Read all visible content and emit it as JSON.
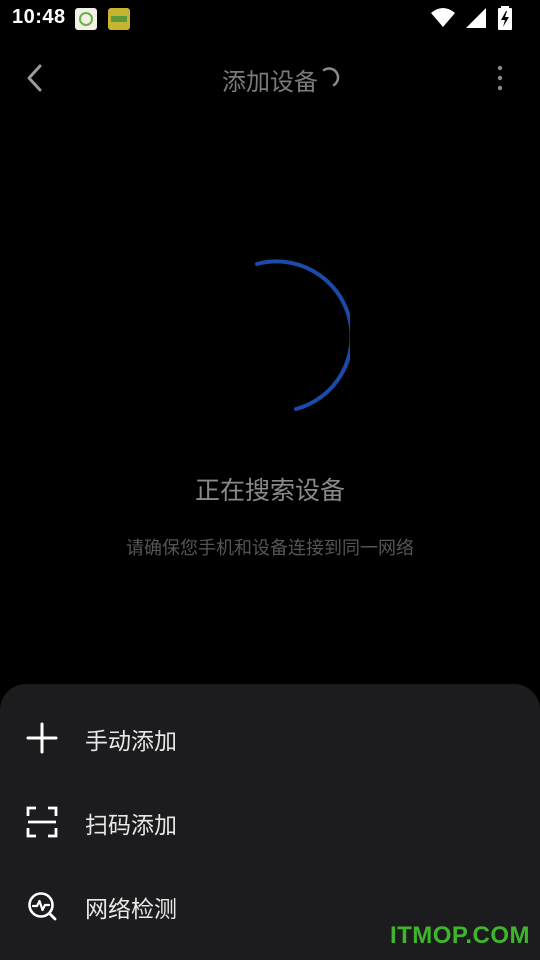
{
  "status_bar": {
    "time": "10:48",
    "notifications": [
      "app-notification-icon",
      "app-notification-icon"
    ],
    "icons": [
      "wifi-icon",
      "cell-signal-icon",
      "battery-charging-icon"
    ]
  },
  "toolbar": {
    "title": "添加设备",
    "back_icon": "chevron-left-icon",
    "more_icon": "more-vertical-icon"
  },
  "main": {
    "status": "正在搜索设备",
    "hint": "请确保您手机和设备连接到同一网络",
    "spinner_color": "#1c4aa8"
  },
  "sheet": {
    "items": [
      {
        "label": "手动添加",
        "icon": "plus-icon"
      },
      {
        "label": "扫码添加",
        "icon": "scan-icon"
      },
      {
        "label": "网络检测",
        "icon": "network-check-icon"
      }
    ]
  },
  "watermark": "ITMOP.COM"
}
